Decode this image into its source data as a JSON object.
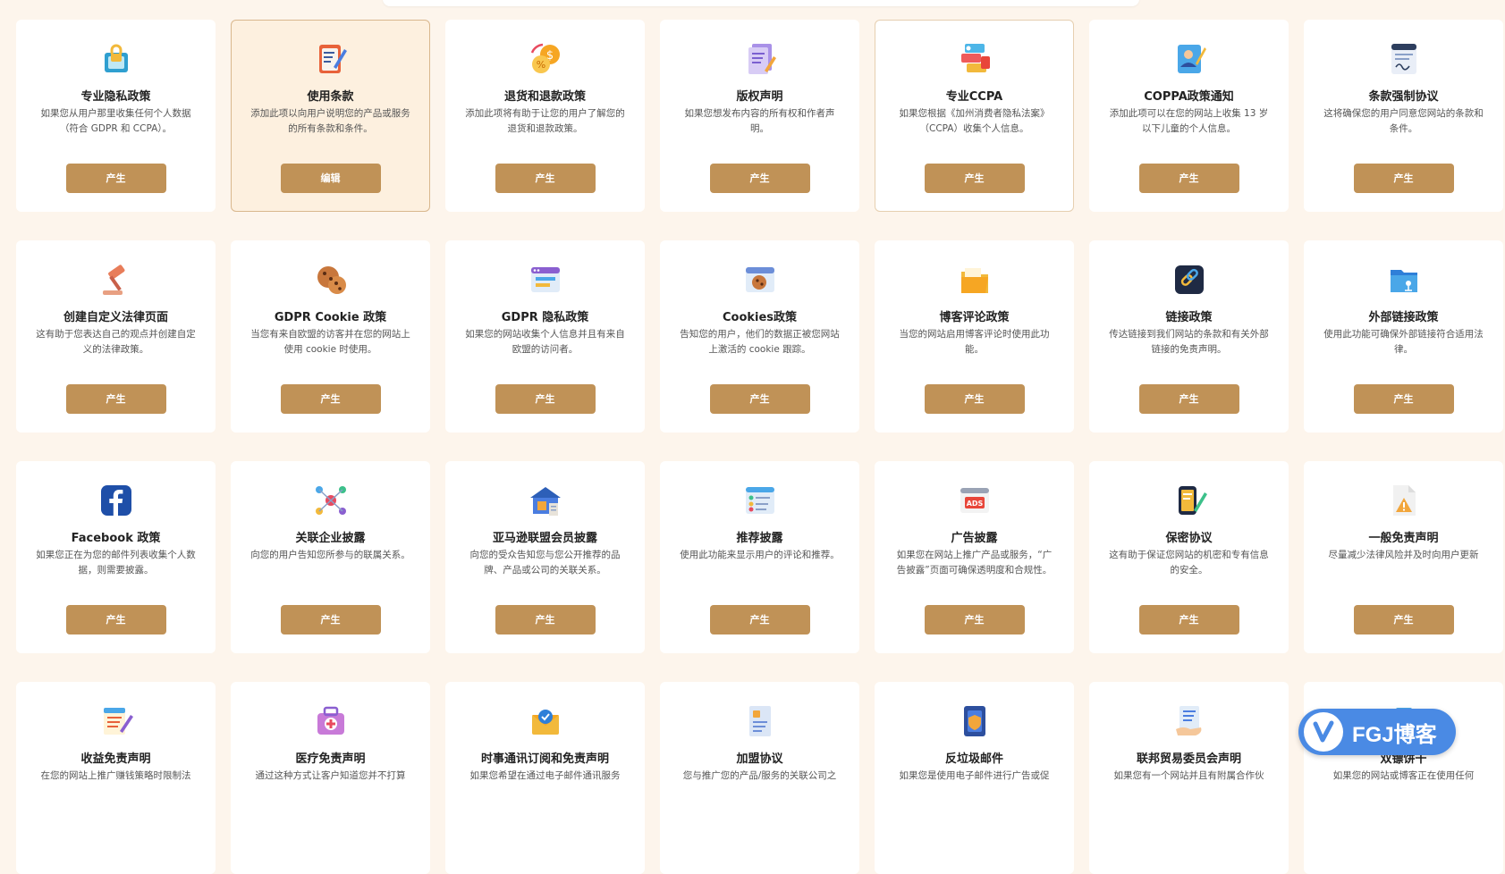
{
  "colors": {
    "page_background": "#fdf5ec",
    "button": "#c09257",
    "active_card": "#fdf0df",
    "badge": "#4a8ae4"
  },
  "cards": [
    {
      "title": "专业隐私政策",
      "desc": "如果您从用户那里收集任何个人数据（符合 GDPR 和 CCPA）。",
      "button": "产生",
      "icon": "lock-document-icon",
      "state": "normal"
    },
    {
      "title": "使用条款",
      "desc": "添加此项以向用户说明您的产品或服务的所有条款和条件。",
      "button": "编辑",
      "icon": "writing-pad-icon",
      "state": "active"
    },
    {
      "title": "退货和退款政策",
      "desc": "添加此项将有助于让您的用户了解您的退货和退款政策。",
      "button": "产生",
      "icon": "refund-coins-icon",
      "state": "normal"
    },
    {
      "title": "版权声明",
      "desc": "如果您想发布内容的所有权和作者声明。",
      "button": "产生",
      "icon": "copyright-document-icon",
      "state": "normal"
    },
    {
      "title": "专业CCPA",
      "desc": "如果您根据《加州消费者隐私法案》（CCPA）收集个人信息。",
      "button": "产生",
      "icon": "id-cards-icon",
      "state": "outlined"
    },
    {
      "title": "COPPA政策通知",
      "desc": "添加此项可以在您的网站上收集 13 岁以下儿童的个人信息。",
      "button": "产生",
      "icon": "child-profile-icon",
      "state": "normal"
    },
    {
      "title": "条款强制协议",
      "desc": "这将确保您的用户同意您网站的条款和条件。",
      "button": "产生",
      "icon": "signed-agreement-icon",
      "state": "normal"
    },
    {
      "title": "创建自定义法律页面",
      "desc": "这有助于您表达自己的观点并创建自定义的法律政策。",
      "button": "产生",
      "icon": "gavel-icon",
      "state": "normal"
    },
    {
      "title": "GDPR Cookie 政策",
      "desc": "当您有来自欧盟的访客并在您的网站上使用 cookie 时使用。",
      "button": "产生",
      "icon": "cookies-icon",
      "state": "normal"
    },
    {
      "title": "GDPR 隐私政策",
      "desc": "如果您的网站收集个人信息并且有来自欧盟的访问者。",
      "button": "产生",
      "icon": "browser-window-icon",
      "state": "normal"
    },
    {
      "title": "Cookies政策",
      "desc": "告知您的用户，他们的数据正被您网站上激活的 cookie 跟踪。",
      "button": "产生",
      "icon": "cookie-browser-icon",
      "state": "normal"
    },
    {
      "title": "博客评论政策",
      "desc": "当您的网站启用博客评论时使用此功能。",
      "button": "产生",
      "icon": "folder-icon",
      "state": "normal"
    },
    {
      "title": "链接政策",
      "desc": "传达链接到我们网站的条款和有关外部链接的免责声明。",
      "button": "产生",
      "icon": "chain-link-icon",
      "state": "normal"
    },
    {
      "title": "外部链接政策",
      "desc": "使用此功能可确保外部链接符合适用法律。",
      "button": "产生",
      "icon": "network-folder-icon",
      "state": "normal"
    },
    {
      "title": "Facebook 政策",
      "desc": "如果您正在为您的邮件列表收集个人数据，则需要披露。",
      "button": "产生",
      "icon": "facebook-icon",
      "state": "normal"
    },
    {
      "title": "关联企业披露",
      "desc": "向您的用户告知您所参与的联属关系。",
      "button": "产生",
      "icon": "network-nodes-icon",
      "state": "normal"
    },
    {
      "title": "亚马逊联盟会员披露",
      "desc": "向您的受众告知您与您公开推荐的品牌、产品或公司的关联关系。",
      "button": "产生",
      "icon": "warehouse-icon",
      "state": "normal"
    },
    {
      "title": "推荐披露",
      "desc": "使用此功能来显示用户的评论和推荐。",
      "button": "产生",
      "icon": "review-list-icon",
      "state": "normal"
    },
    {
      "title": "广告披露",
      "desc": "如果您在网站上推广产品或服务，“广告披露”页面可确保透明度和合规性。",
      "button": "产生",
      "icon": "ads-window-icon",
      "state": "normal"
    },
    {
      "title": "保密协议",
      "desc": "这有助于保证您网站的机密和专有信息的安全。",
      "button": "产生",
      "icon": "phone-pencil-icon",
      "state": "normal"
    },
    {
      "title": "一般免责声明",
      "desc": "尽量减少法律风险并及时向用户更新",
      "button": "产生",
      "icon": "warning-document-icon",
      "state": "normal"
    },
    {
      "title": "收益免责声明",
      "desc": "在您的网站上推广赚钱策略时限制法",
      "button": "",
      "icon": "notepad-icon",
      "state": "normal"
    },
    {
      "title": "医疗免责声明",
      "desc": "通过这种方式让客户知道您并不打算",
      "button": "",
      "icon": "medical-kit-icon",
      "state": "normal"
    },
    {
      "title": "时事通讯订阅和免责声明",
      "desc": "如果您希望在通过电子邮件通讯服务",
      "button": "",
      "icon": "mail-check-icon",
      "state": "normal"
    },
    {
      "title": "加盟协议",
      "desc": "您与推广您的产品/服务的关联公司之",
      "button": "",
      "icon": "agreement-document-icon",
      "state": "normal"
    },
    {
      "title": "反垃圾邮件",
      "desc": "如果您是使用电子邮件进行广告或促",
      "button": "",
      "icon": "anti-spam-icon",
      "state": "normal"
    },
    {
      "title": "联邦贸易委员会声明",
      "desc": "如果您有一个网站并且有附属合作伙",
      "button": "",
      "icon": "hand-document-icon",
      "state": "normal"
    },
    {
      "title": "双镖饼干",
      "desc": "如果您的网站或博客正在使用任何",
      "button": "",
      "icon": "cookie-jar-icon",
      "state": "normal"
    }
  ],
  "badge": {
    "text": "FGJ博客",
    "icon": "check-logo-icon"
  }
}
